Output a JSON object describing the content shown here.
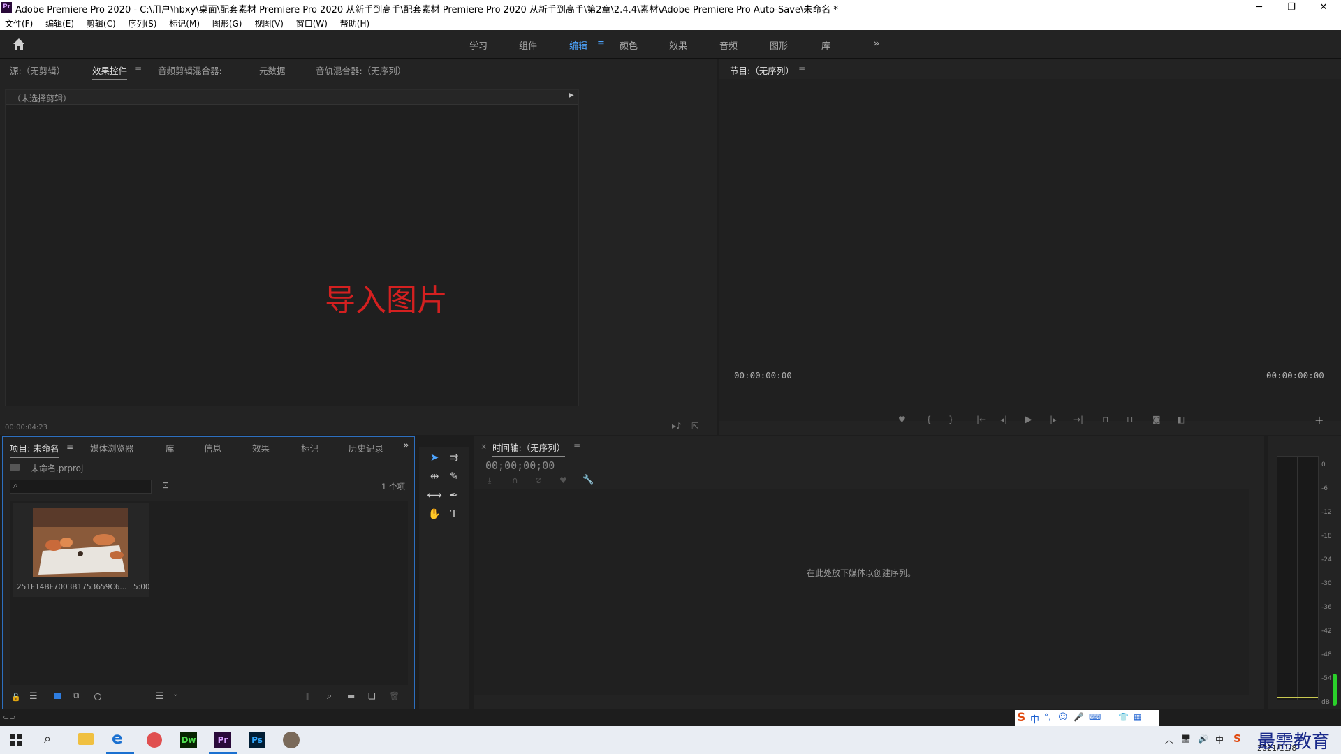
{
  "window": {
    "app_icon": "Pr",
    "title": "Adobe Premiere Pro 2020 - C:\\用户\\hbxy\\桌面\\配套素材 Premiere Pro 2020 从新手到高手\\配套素材 Premiere Pro 2020 从新手到高手\\第2章\\2.4.4\\素材\\Adobe Premiere Pro Auto-Save\\未命名 *",
    "min": "─",
    "max": "❐",
    "close": "✕"
  },
  "menu": [
    "文件(F)",
    "编辑(E)",
    "剪辑(C)",
    "序列(S)",
    "标记(M)",
    "图形(G)",
    "视图(V)",
    "窗口(W)",
    "帮助(H)"
  ],
  "workspaces": [
    "学习",
    "组件",
    "编辑",
    "颜色",
    "效果",
    "音频",
    "图形",
    "库"
  ],
  "workspace_active": "编辑",
  "workspace_more": "»",
  "source_panel": {
    "tabs": [
      "源:（无剪辑）",
      "效果控件",
      "音频剪辑混合器:",
      "元数据",
      "音轨混合器:（无序列）"
    ],
    "active_tab": "效果控件",
    "header": "（未选择剪辑）",
    "overlay_text": "导入图片",
    "timecode": "00:00:04:23"
  },
  "program_panel": {
    "title": "节目:（无序列）",
    "timecode_left": "00:00:00:00",
    "timecode_right": "00:00:00:00"
  },
  "project_panel": {
    "tabs": [
      "项目: 未命名",
      "媒体浏览器",
      "库",
      "信息",
      "效果",
      "标记",
      "历史记录"
    ],
    "active_tab": "项目: 未命名",
    "project_file": "未命名.prproj",
    "search_placeholder": "",
    "item_count": "1 个项",
    "items": [
      {
        "name": "251F14BF7003B1753659C6...",
        "duration": "5:00"
      }
    ]
  },
  "timeline_panel": {
    "title": "时间轴:（无序列）",
    "close": "×",
    "timecode": "00;00;00;00",
    "drop_hint": "在此处放下媒体以创建序列。"
  },
  "audio_meter": {
    "labels": [
      "0",
      "-6",
      "-12",
      "-18",
      "-24",
      "-30",
      "-36",
      "-42",
      "-48",
      "-54",
      "dB"
    ]
  },
  "ime_bar": {
    "items": [
      "中",
      "°,",
      "☺",
      "🎤",
      "⌨",
      "👕",
      "▦"
    ]
  },
  "taskbar": {
    "apps": [
      "Dw",
      "Pr",
      "Ps"
    ],
    "date": "2021/11/8",
    "watermark": "最需教育"
  },
  "colors": {
    "accent": "#4ea5ff",
    "overlay_red": "#d42020",
    "panel": "#232323",
    "bg": "#1d1d1d"
  }
}
